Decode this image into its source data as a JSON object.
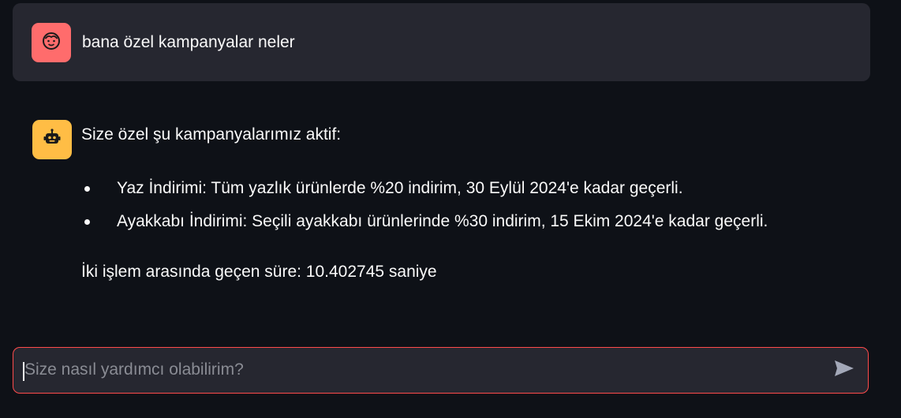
{
  "chat": {
    "user_message": {
      "text": "bana özel kampanyalar neler",
      "avatar_icon": "user-face-icon",
      "avatar_color": "#ff6c6c"
    },
    "assistant_message": {
      "intro": "Size özel şu kampanyalarımız aktif:",
      "items": [
        "Yaz İndirimi: Tüm yazlık ürünlerde %20 indirim, 30 Eylül 2024'e kadar geçerli.",
        "Ayakkabı İndirimi: Seçili ayakkabı ürünlerinde %30 indirim, 15 Ekim 2024'e kadar geçerli."
      ],
      "footer": "İki işlem arasında geçen süre: 10.402745 saniye",
      "avatar_icon": "robot-icon",
      "avatar_color": "#ffbd45"
    }
  },
  "input": {
    "placeholder": "Size nasıl yardımcı olabilirim?",
    "value": "",
    "send_icon": "send-icon",
    "border_color": "#ff4b4b"
  },
  "theme": {
    "background": "#0e1117",
    "message_background": "#262730",
    "text": "#fafafa"
  }
}
